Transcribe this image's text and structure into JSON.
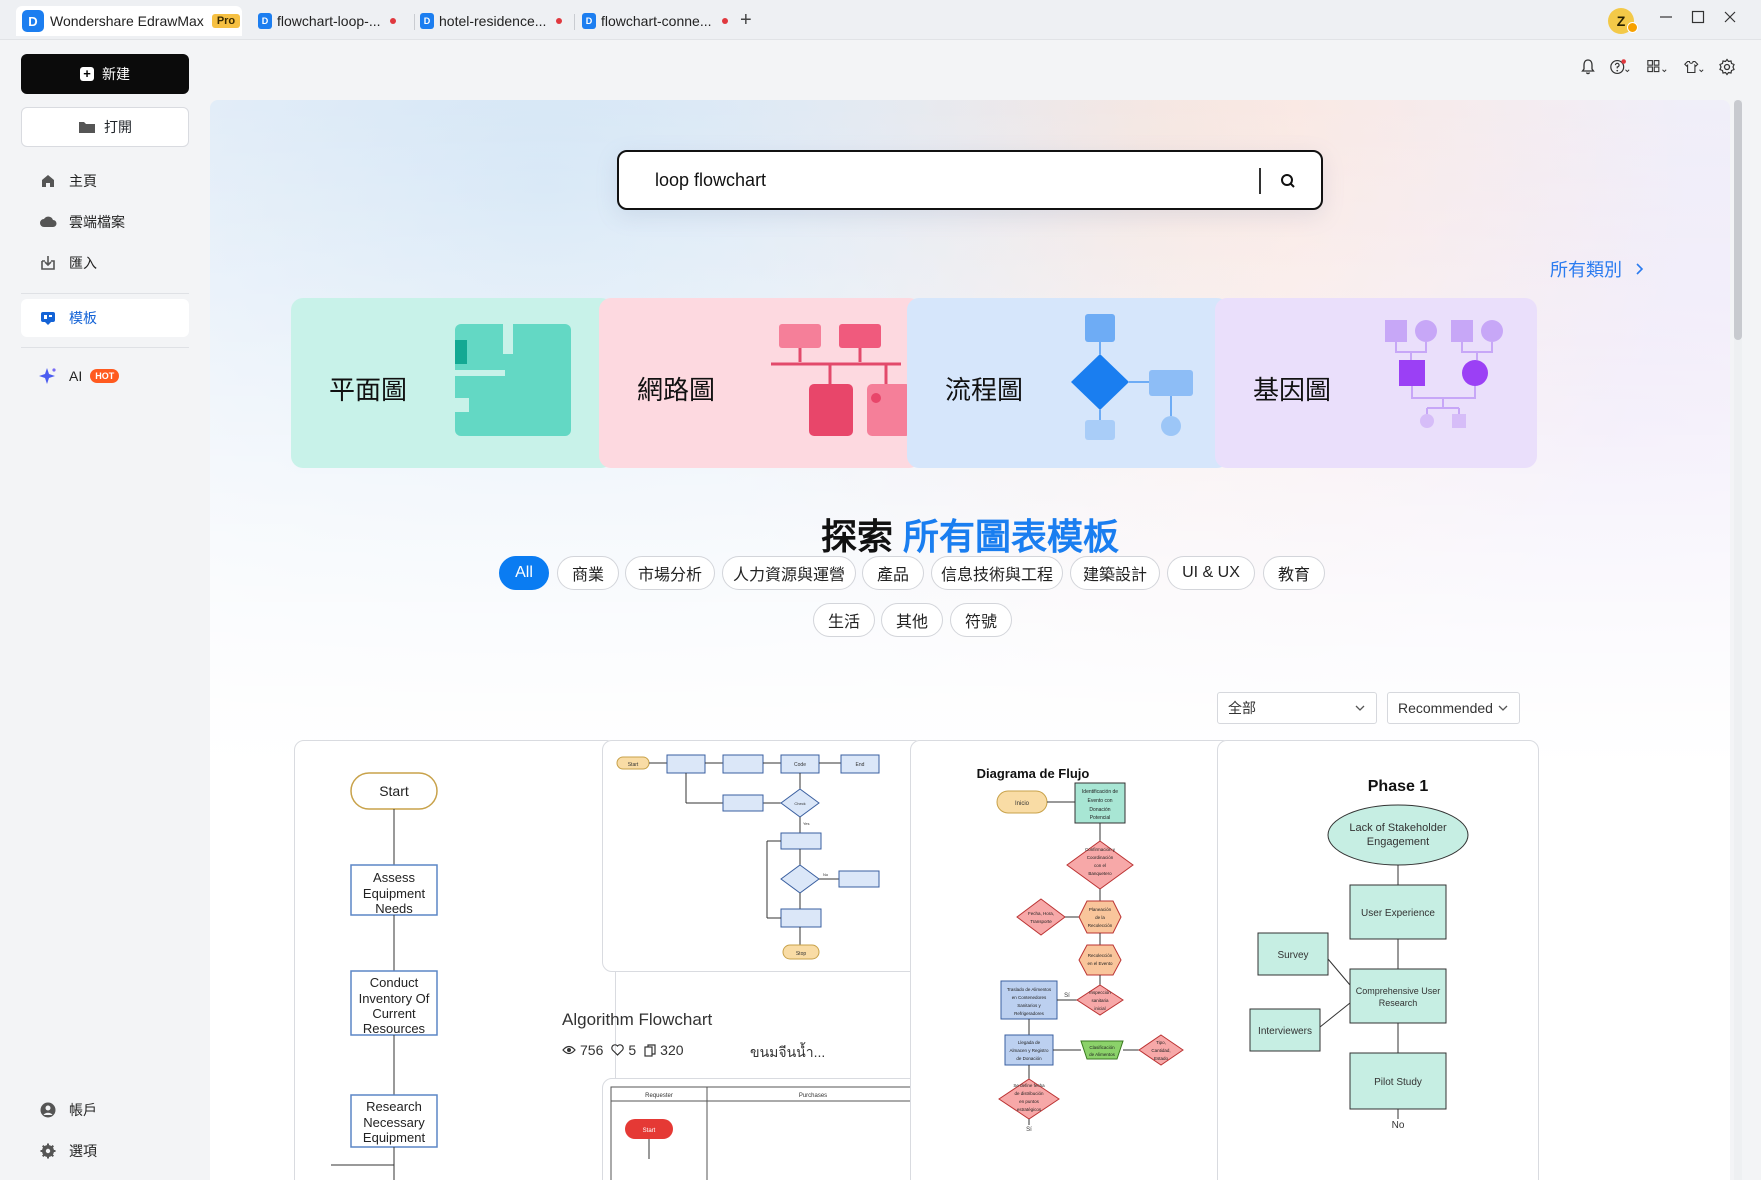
{
  "titlebar": {
    "app_name": "Wondershare EdrawMax",
    "app_badge": "Pro",
    "tabs": [
      {
        "label": "flowchart-loop-...",
        "unsaved": true
      },
      {
        "label": "hotel-residence...",
        "unsaved": true
      },
      {
        "label": "flowchart-conne...",
        "unsaved": true
      }
    ],
    "new_tab": "+",
    "user_initial": "Z"
  },
  "toolbar": {
    "icons": [
      "bell-icon",
      "help-icon",
      "apps-icon",
      "shirt-icon",
      "gear-icon"
    ]
  },
  "sidebar": {
    "new_label": "新建",
    "open_label": "打開",
    "nav": [
      {
        "label": "主頁",
        "icon": "home-icon"
      },
      {
        "label": "雲端檔案",
        "icon": "cloud-icon"
      },
      {
        "label": "匯入",
        "icon": "import-icon"
      }
    ],
    "templates_label": "模板",
    "ai_label": "AI",
    "hot_badge": "HOT",
    "account_label": "帳戶",
    "options_label": "選項"
  },
  "main": {
    "search": {
      "value": "loop flowchart"
    },
    "all_categories": "所有類別",
    "category_cards": [
      {
        "label": "平面圖",
        "color": "#c8f2e9"
      },
      {
        "label": "網路圖",
        "color": "#fdd9e0"
      },
      {
        "label": "流程圖",
        "color": "#d6e6fb"
      },
      {
        "label": "基因圖",
        "color": "#eadffb"
      }
    ],
    "explore": {
      "prefix": "探索",
      "highlight": "所有圖表模板"
    },
    "filters_row1": [
      "All",
      "商業",
      "市場分析",
      "人力資源與運營",
      "產品",
      "信息技術與工程",
      "建築設計",
      "UI & UX",
      "教育"
    ],
    "filters_row2": [
      "生活",
      "其他",
      "符號"
    ],
    "active_filter": "All",
    "scope_select": "全部",
    "sort_select": "Recommended"
  },
  "cards": {
    "card1": {
      "nodes": [
        "Start",
        "Assess",
        "Equipment",
        "Needs",
        "Conduct",
        "Inventory Of",
        "Current",
        "Resources",
        "Research",
        "Necessary",
        "Equipment"
      ]
    },
    "card2": {
      "title": "Algorithm Flowchart",
      "views": "756",
      "likes": "5",
      "copies": "320",
      "author": "ขนมจีนน้ำ...",
      "nodes": [
        "Start",
        "Check",
        "Code",
        "End",
        "Yes",
        "No",
        "Stop"
      ]
    },
    "card3": {
      "heading": "Diagrama de Flujo",
      "nodes": [
        "Inicio",
        "Identificación de",
        "Evento con",
        "Donación",
        "Potencial",
        "Confirmación y",
        "Coordinación",
        "con el",
        "Banquetero",
        "Fecha, Hora,",
        "Transporte",
        "Planeación",
        "de la",
        "Recolección",
        "Recolección",
        "en el Evento",
        "Traslado de Alimentos",
        "en Contenedores",
        "Sanitarios y",
        "Refrigeradores",
        "Sí",
        "Inspección",
        "sanitaria",
        "inicial",
        "Llegada de",
        "Almacen y Registro",
        "de Donación",
        "Clasificación",
        "de Alimentos",
        "Tipo,",
        "Cantidad,",
        "Estado",
        "Se define fecha",
        "de distribución",
        "en puntos",
        "estratégicos",
        "Sí"
      ]
    },
    "card4": {
      "heading": "Phase 1",
      "nodes": [
        "Lack of Stakeholder",
        "Engagement",
        "User Experience",
        "Survey",
        "Comprehensive User",
        "Research",
        "Interviewers",
        "Pilot Study",
        "No"
      ]
    },
    "card5": {
      "headers": [
        "Requester",
        "Purchases"
      ],
      "start": "Start"
    }
  }
}
